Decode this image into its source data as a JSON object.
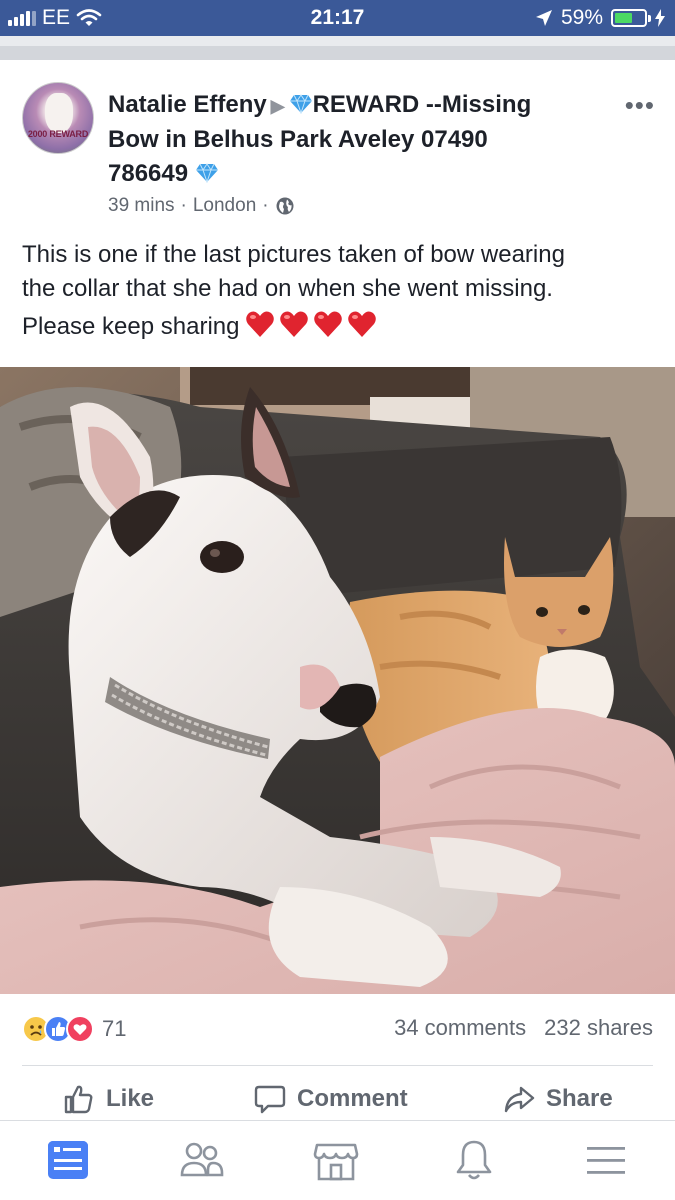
{
  "status_bar": {
    "carrier": "EE",
    "time": "21:17",
    "battery_percent": "59%",
    "battery_level": 0.59
  },
  "post": {
    "author": "Natalie Effeny",
    "avatar_badge": "2000 REWARD",
    "title_part1": "REWARD --Missing",
    "title_part2": "Bow in Belhus Park Aveley 07490",
    "title_part3": "786649",
    "time_ago": "39 mins",
    "location": "London",
    "separator": "·",
    "body_line1": "This is one if the last pictures taken of bow wearing",
    "body_line2": "the collar that she had on when she went missing.",
    "body_line3": "Please keep sharing",
    "heart_count": 4
  },
  "engagement": {
    "reaction_count": "71",
    "comments": "34 comments",
    "shares": "232 shares"
  },
  "actions": {
    "like": "Like",
    "comment": "Comment",
    "share": "Share"
  },
  "bottom_nav": {
    "items": [
      "news-feed-icon",
      "friends-icon",
      "marketplace-icon",
      "notifications-icon",
      "menu-icon"
    ]
  },
  "colors": {
    "facebook_blue": "#3b5998",
    "nav_active": "#4267b2",
    "diamond": "#3ea0e8",
    "heart": "#e0242f"
  }
}
